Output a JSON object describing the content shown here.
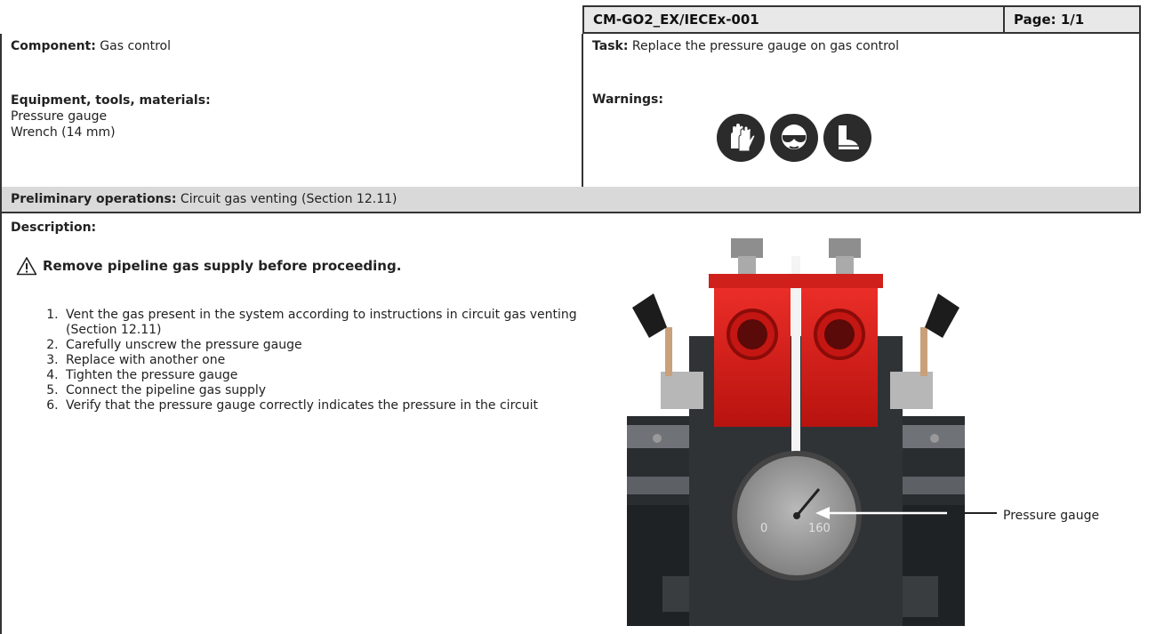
{
  "header": {
    "code": "CM-GO2_EX/IECEx-001",
    "page": "Page: 1/1"
  },
  "component": {
    "label": "Component:",
    "value": "Gas control"
  },
  "task": {
    "label": "Task:",
    "value": "Replace the pressure gauge on gas control"
  },
  "equipment": {
    "label": "Equipment, tools, materials:",
    "items": [
      "Pressure gauge",
      "Wrench (14 mm)"
    ]
  },
  "warnings": {
    "label": "Warnings:",
    "icons": [
      "gloves-icon",
      "safety-glasses-icon",
      "safety-boots-icon"
    ]
  },
  "preliminary": {
    "label": "Preliminary operations:",
    "value": "Circuit gas venting (Section 12.11)"
  },
  "description": {
    "label": "Description:",
    "notice": "Remove pipeline gas supply before proceeding.",
    "steps": [
      "Vent the gas present in the system according to instructions in circuit gas venting (Section 12.11)",
      "Carefully unscrew the pressure gauge",
      "Replace with another one",
      "Tighten the pressure gauge",
      "Connect the pipeline gas supply",
      "Verify that the pressure gauge correctly indicates the pressure in the circuit"
    ]
  },
  "figure": {
    "callout": "Pressure gauge",
    "gauge_ticks": [
      "0",
      "160"
    ],
    "colors": {
      "regulator": "#e0201a",
      "body": "#2f3336",
      "gauge_face": "#9a9a9a"
    }
  }
}
